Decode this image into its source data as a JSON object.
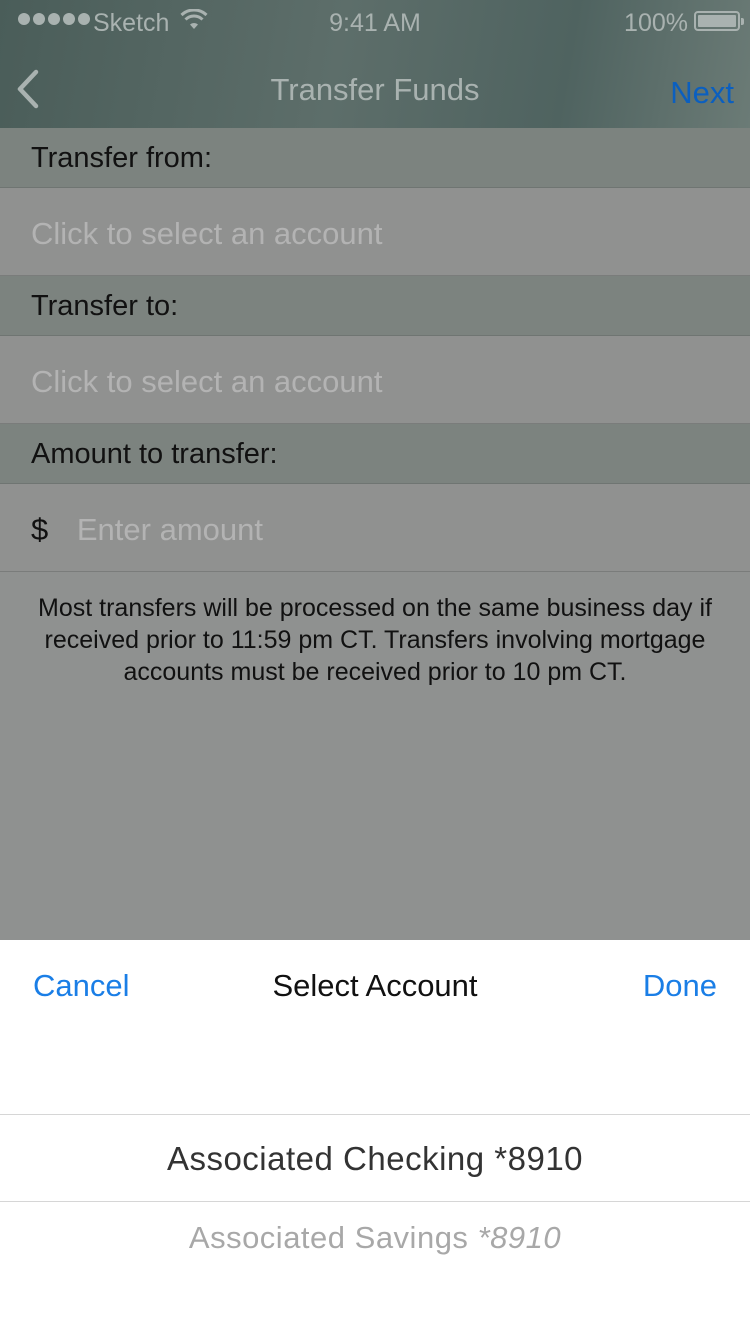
{
  "status_bar": {
    "carrier": "Sketch",
    "time": "9:41 AM",
    "battery": "100%"
  },
  "nav": {
    "title": "Transfer Funds",
    "next_label": "Next"
  },
  "form": {
    "from_label": "Transfer from:",
    "from_placeholder": "Click to select an account",
    "to_label": "Transfer to:",
    "to_placeholder": "Click to select an account",
    "amount_label": "Amount to transfer:",
    "currency_symbol": "$",
    "amount_placeholder": "Enter amount"
  },
  "notice": "Most transfers will be processed on the same business day if received prior to 11:59 pm CT. Transfers involving mortgage accounts must be received prior to 10 pm CT.",
  "picker": {
    "cancel_label": "Cancel",
    "title": "Select Account",
    "done_label": "Done",
    "options": [
      {
        "name": "Associated Checking",
        "number": "*8910"
      },
      {
        "name": "Associated Savings",
        "number": "*8910"
      }
    ]
  },
  "colors": {
    "accent": "#1a7ee6",
    "nav_accent": "#0b5fbf",
    "section_header_bg": "#7c837f"
  }
}
